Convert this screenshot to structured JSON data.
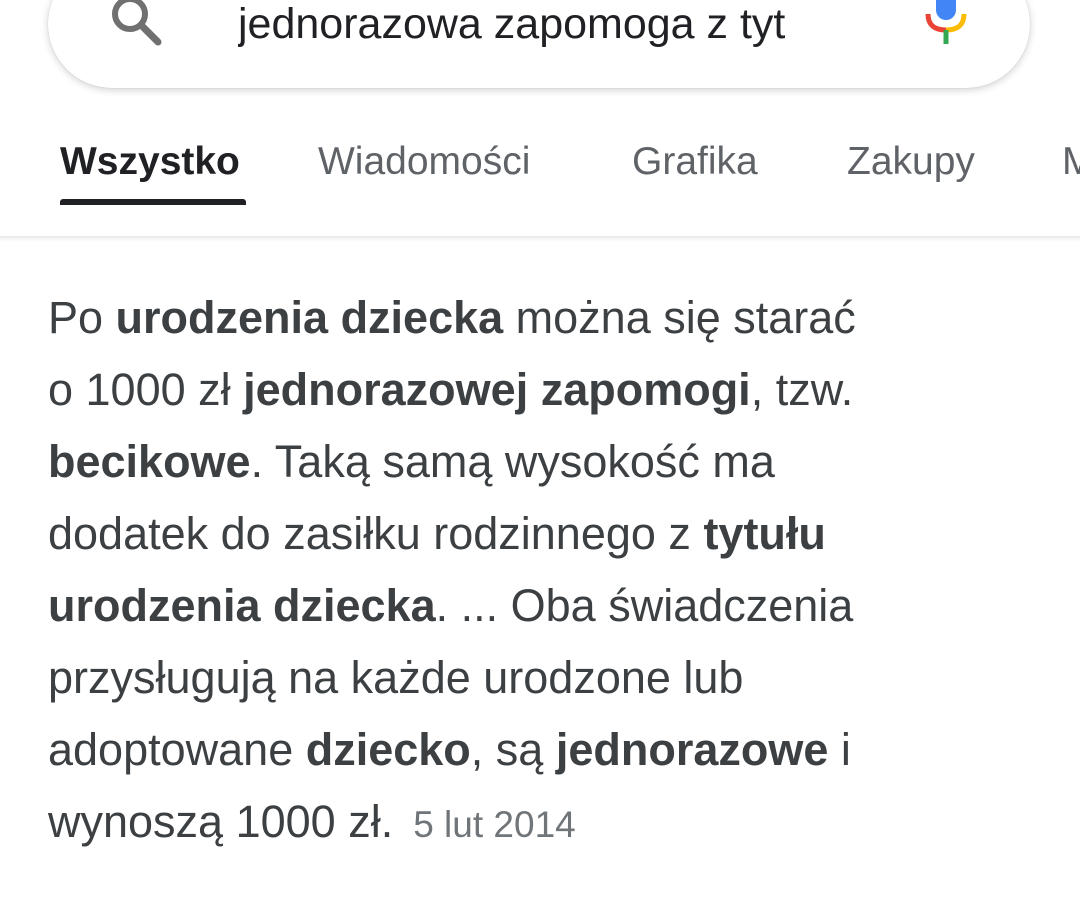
{
  "search": {
    "query": "jednorazowa zapomoga z tyt"
  },
  "tabs": [
    {
      "label": "Wszystko",
      "active": true
    },
    {
      "label": "Wiadomości",
      "active": false
    },
    {
      "label": "Grafika",
      "active": false
    },
    {
      "label": "Zakupy",
      "active": false
    },
    {
      "label": "M",
      "active": false
    }
  ],
  "snippet": {
    "lines": [
      [
        {
          "t": "Po ",
          "b": false
        },
        {
          "t": "urodzenia dziecka",
          "b": true
        },
        {
          "t": " można się starać",
          "b": false
        }
      ],
      [
        {
          "t": "o 1000 zł ",
          "b": false
        },
        {
          "t": "jednorazowej zapomogi",
          "b": true
        },
        {
          "t": ", tzw.",
          "b": false
        }
      ],
      [
        {
          "t": "becikowe",
          "b": true
        },
        {
          "t": ". Taką samą wysokość ma",
          "b": false
        }
      ],
      [
        {
          "t": "dodatek do zasiłku rodzinnego z ",
          "b": false
        },
        {
          "t": "tytułu",
          "b": true
        }
      ],
      [
        {
          "t": "urodzenia dziecka",
          "b": true
        },
        {
          "t": ". ... Oba świadczenia",
          "b": false
        }
      ],
      [
        {
          "t": "przysługują na każde urodzone lub",
          "b": false
        }
      ],
      [
        {
          "t": "adoptowane ",
          "b": false
        },
        {
          "t": "dziecko",
          "b": true
        },
        {
          "t": ", są ",
          "b": false
        },
        {
          "t": "jednorazowe",
          "b": true
        },
        {
          "t": " i",
          "b": false
        }
      ],
      [
        {
          "t": "wynoszą 1000 zł.",
          "b": false
        }
      ]
    ],
    "date": "5 lut 2014"
  },
  "colors": {
    "text": "#3c4043",
    "tab_inactive": "#5f6368",
    "tab_active": "#202124",
    "date": "#70757a"
  },
  "icons": {
    "search": "search-icon",
    "mic": "mic-icon"
  }
}
